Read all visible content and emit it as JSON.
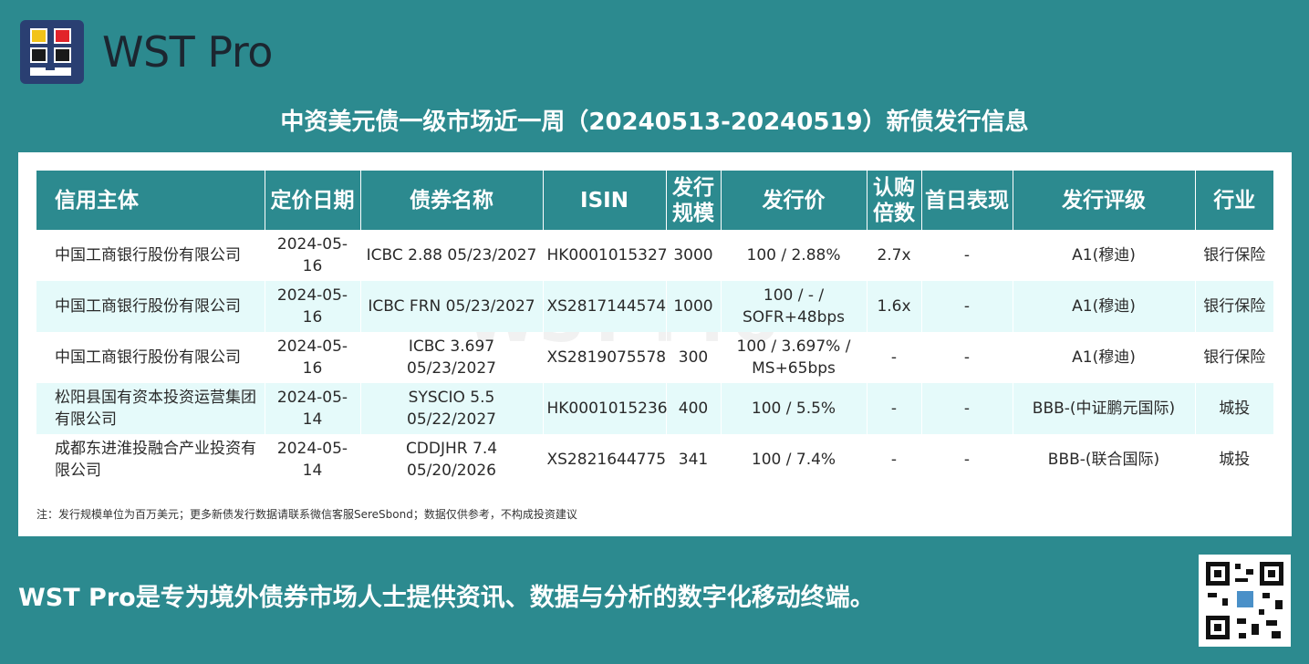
{
  "brand": {
    "name": "WST Pro"
  },
  "title": "中资美元债一级市场近一周（20240513-20240519）新债发行信息",
  "table": {
    "headers": [
      "信用主体",
      "定价日期",
      "债券名称",
      "ISIN",
      "发行规模",
      "发行价",
      "认购倍数",
      "首日表现",
      "发行评级",
      "行业"
    ],
    "rows": [
      [
        "中国工商银行股份有限公司",
        "2024-05-16",
        "ICBC 2.88 05/23/2027",
        "HK0001015327",
        "3000",
        "100 / 2.88%",
        "2.7x",
        "-",
        "A1(穆迪)",
        "银行保险"
      ],
      [
        "中国工商银行股份有限公司",
        "2024-05-16",
        "ICBC FRN 05/23/2027",
        "XS2817144574",
        "1000",
        "100 / - / SOFR+48bps",
        "1.6x",
        "-",
        "A1(穆迪)",
        "银行保险"
      ],
      [
        "中国工商银行股份有限公司",
        "2024-05-16",
        "ICBC 3.697 05/23/2027",
        "XS2819075578",
        "300",
        "100 / 3.697% / MS+65bps",
        "-",
        "-",
        "A1(穆迪)",
        "银行保险"
      ],
      [
        "松阳县国有资本投资运营集团有限公司",
        "2024-05-14",
        "SYSCIO 5.5 05/22/2027",
        "HK0001015236",
        "400",
        "100 / 5.5%",
        "-",
        "-",
        "BBB-(中证鹏元国际)",
        "城投"
      ],
      [
        "成都东进淮投融合产业投资有限公司",
        "2024-05-14",
        "CDDJHR 7.4 05/20/2026",
        "XS2821644775",
        "341",
        "100 / 7.4%",
        "-",
        "-",
        "BBB-(联合国际)",
        "城投"
      ]
    ]
  },
  "note": "注：发行规模单位为百万美元；更多新债发行数据请联系微信客服SereSbond；数据仅供参考，不构成投资建议",
  "watermark": "WST Pro",
  "tagline": "WST Pro是专为境外债券市场人士提供资讯、数据与分析的数字化移动终端。",
  "colors": {
    "background": "#2c8a8f",
    "header": "#2c8a8f",
    "row_alt": "#e5fafa"
  }
}
